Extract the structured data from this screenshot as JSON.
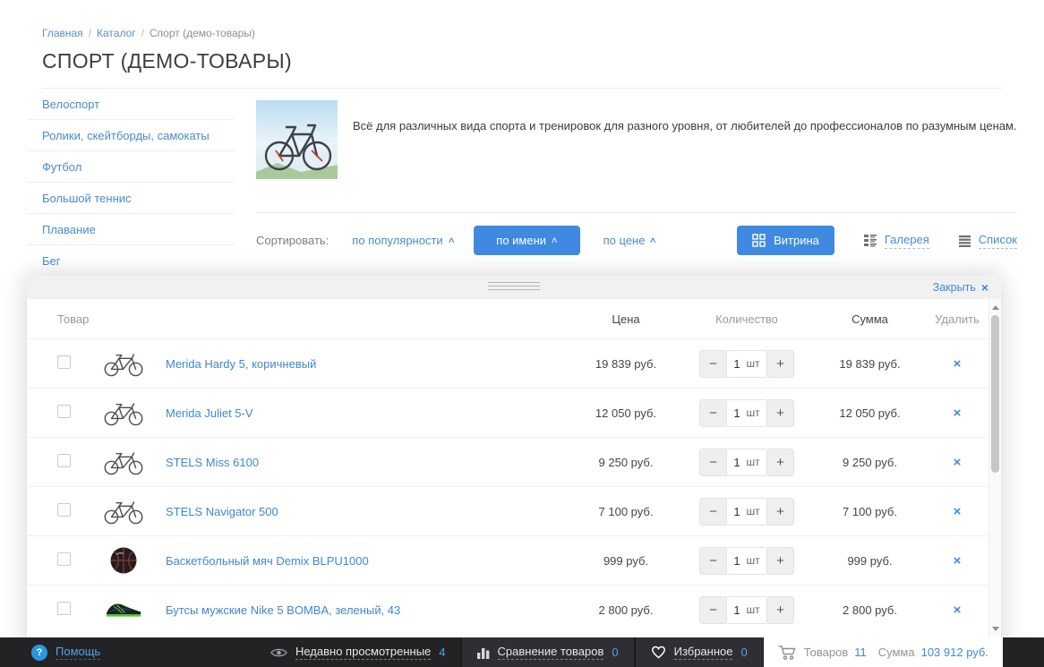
{
  "page": {
    "breadcrumb": {
      "separator": "/",
      "items": [
        {
          "label": "Главная"
        },
        {
          "label": "Каталог"
        },
        {
          "label": "Спорт (демо-товары)"
        }
      ]
    },
    "title": "СПОРТ (ДЕМО-ТОВАРЫ)"
  },
  "sidebar": {
    "items": [
      {
        "label": "Велоспорт"
      },
      {
        "label": "Ролики, скейтборды, самокаты"
      },
      {
        "label": "Футбол"
      },
      {
        "label": "Большой теннис"
      },
      {
        "label": "Плавание"
      },
      {
        "label": "Бег"
      }
    ]
  },
  "category": {
    "image_icon": "bicycle-photo",
    "description": "Всё для различных вида спорта и тренировок для разного уровня, от любителей до профессионалов по разумным ценам."
  },
  "sorting": {
    "label": "Сортировать:",
    "caret": "∧",
    "options": [
      {
        "label": "по популярности",
        "active": false
      },
      {
        "label": "по имени",
        "active": true
      },
      {
        "label": "по цене",
        "active": false
      }
    ]
  },
  "views": {
    "options": [
      {
        "label": "Витрина",
        "icon": "grid-icon",
        "active": true
      },
      {
        "label": "Галерея",
        "icon": "gallery-icon",
        "active": false
      },
      {
        "label": "Список",
        "icon": "list-icon",
        "active": false
      }
    ]
  },
  "cart_panel": {
    "close_label": "Закрыть",
    "close_icon": "×",
    "delete_icon": "×",
    "quantity_unit": "шт",
    "stepper": {
      "minus": "−",
      "plus": "+"
    },
    "columns": {
      "product": "Товар",
      "price": "Цена",
      "quantity": "Количество",
      "sum": "Сумма",
      "delete": "Удалить"
    },
    "rows": [
      {
        "name": "Merida Hardy 5, коричневый",
        "price": "19 839 руб.",
        "qty": "1",
        "sum": "19 839 руб.",
        "icon": "bike-icon"
      },
      {
        "name": "Merida Juliet 5-V",
        "price": "12 050 руб.",
        "qty": "1",
        "sum": "12 050 руб.",
        "icon": "bike-icon"
      },
      {
        "name": "STELS Miss 6100",
        "price": "9 250 руб.",
        "qty": "1",
        "sum": "9 250 руб.",
        "icon": "bike-icon"
      },
      {
        "name": "STELS Navigator 500",
        "price": "7 100 руб.",
        "qty": "1",
        "sum": "7 100 руб.",
        "icon": "bike-icon"
      },
      {
        "name": "Баскетбольный мяч Demix BLPU1000",
        "price": "999 руб.",
        "qty": "1",
        "sum": "999 руб.",
        "icon": "basketball-icon"
      },
      {
        "name": "Бутсы мужские Nike 5 BOMBA, зеленый, 43",
        "price": "2 800 руб.",
        "qty": "1",
        "sum": "2 800 руб.",
        "icon": "football-boot-icon"
      }
    ]
  },
  "footer": {
    "help": {
      "label": "Помощь",
      "icon": "help-icon",
      "icon_text": "?"
    },
    "recently_viewed": {
      "label": "Недавно просмотренные",
      "count": "4",
      "icon": "eye-icon"
    },
    "compare": {
      "label": "Сравнение товаров",
      "count": "0",
      "icon": "bar-chart-icon"
    },
    "favorites": {
      "label": "Избранное",
      "count": "0",
      "icon": "heart-icon"
    },
    "cart_summary": {
      "icon": "cart-icon",
      "items_label": "Товаров",
      "items_count": "11",
      "sum_label": "Сумма",
      "sum_value": "103 912 руб."
    }
  },
  "colors": {
    "accent_blue": "#3f8ae0",
    "link_blue": "#4a8bcd",
    "footer_dark": "#232326",
    "count_blue": "#4da3e8"
  }
}
